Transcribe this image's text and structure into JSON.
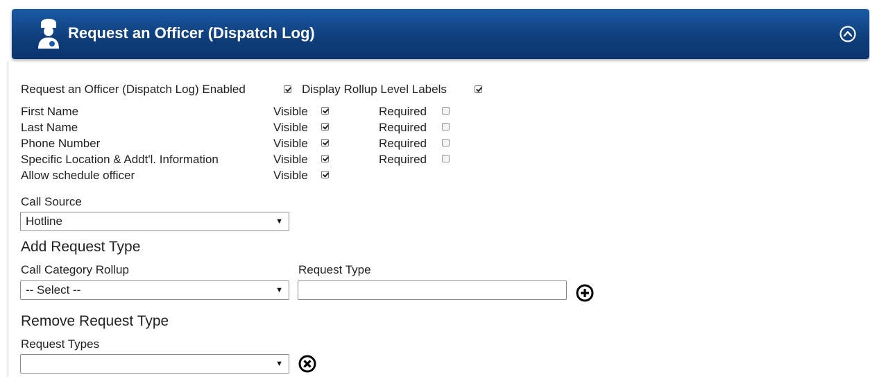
{
  "header": {
    "title": "Request an Officer (Dispatch Log)",
    "icon": "officer-icon",
    "collapse_icon": "chevron-up-circle-icon",
    "color": "#0f3f7c"
  },
  "settings": {
    "enabled_label": "Request an Officer (Dispatch Log) Enabled",
    "enabled_checked": true,
    "rollup_label": "Display Rollup Level Labels",
    "rollup_checked": true
  },
  "fields": [
    {
      "name": "First Name",
      "visible_label": "Visible",
      "visible": true,
      "required_label": "Required",
      "required": false
    },
    {
      "name": "Last Name",
      "visible_label": "Visible",
      "visible": true,
      "required_label": "Required",
      "required": false
    },
    {
      "name": "Phone Number",
      "visible_label": "Visible",
      "visible": true,
      "required_label": "Required",
      "required": false
    },
    {
      "name": "Specific Location & Addt'l. Information",
      "visible_label": "Visible",
      "visible": true,
      "required_label": "Required",
      "required": false
    },
    {
      "name": "Allow schedule officer",
      "visible_label": "Visible",
      "visible": true
    }
  ],
  "call_source": {
    "label": "Call Source",
    "value": "Hotline"
  },
  "add_request": {
    "heading": "Add Request Type",
    "category_label": "Call Category Rollup",
    "category_value": "-- Select --",
    "type_label": "Request Type",
    "type_value": "",
    "add_icon": "plus-circle-icon"
  },
  "remove_request": {
    "heading": "Remove Request Type",
    "types_label": "Request Types",
    "types_value": "",
    "remove_icon": "x-circle-icon"
  }
}
